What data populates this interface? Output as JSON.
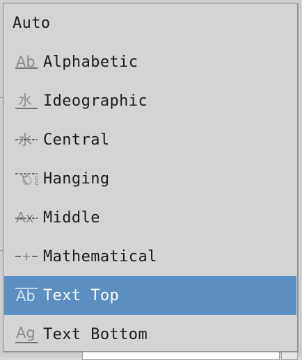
{
  "menu": {
    "items": [
      {
        "label": "Auto",
        "icon": "none",
        "selected": false
      },
      {
        "label": "Alphabetic",
        "icon": "baseline-alphabetic-icon",
        "selected": false
      },
      {
        "label": "Ideographic",
        "icon": "baseline-ideographic-icon",
        "selected": false
      },
      {
        "label": "Central",
        "icon": "baseline-central-icon",
        "selected": false
      },
      {
        "label": "Hanging",
        "icon": "baseline-hanging-icon",
        "selected": false
      },
      {
        "label": "Middle",
        "icon": "baseline-middle-icon",
        "selected": false
      },
      {
        "label": "Mathematical",
        "icon": "baseline-mathematical-icon",
        "selected": false
      },
      {
        "label": "Text Top",
        "icon": "baseline-text-top-icon",
        "selected": true
      },
      {
        "label": "Text Bottom",
        "icon": "baseline-text-bottom-icon",
        "selected": false
      }
    ]
  },
  "colors": {
    "menu_background": "#d4d4d4",
    "selection_background": "#5b8fc1",
    "selection_text": "#ffffff",
    "text": "#1c1c1c",
    "icon_glyph": "#8a8a8a"
  }
}
